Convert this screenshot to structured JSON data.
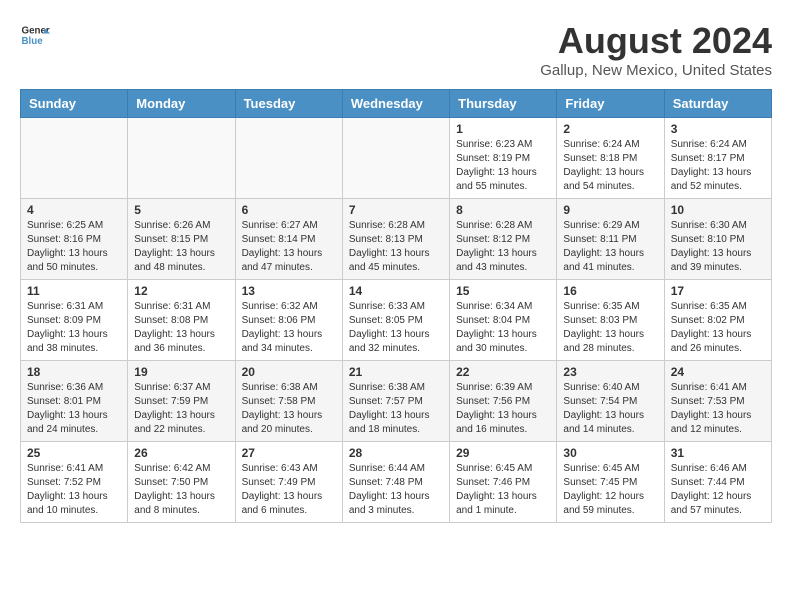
{
  "header": {
    "logo_line1": "General",
    "logo_line2": "Blue",
    "main_title": "August 2024",
    "subtitle": "Gallup, New Mexico, United States"
  },
  "days_of_week": [
    "Sunday",
    "Monday",
    "Tuesday",
    "Wednesday",
    "Thursday",
    "Friday",
    "Saturday"
  ],
  "weeks": [
    [
      {
        "day": "",
        "info": ""
      },
      {
        "day": "",
        "info": ""
      },
      {
        "day": "",
        "info": ""
      },
      {
        "day": "",
        "info": ""
      },
      {
        "day": "1",
        "info": "Sunrise: 6:23 AM\nSunset: 8:19 PM\nDaylight: 13 hours\nand 55 minutes."
      },
      {
        "day": "2",
        "info": "Sunrise: 6:24 AM\nSunset: 8:18 PM\nDaylight: 13 hours\nand 54 minutes."
      },
      {
        "day": "3",
        "info": "Sunrise: 6:24 AM\nSunset: 8:17 PM\nDaylight: 13 hours\nand 52 minutes."
      }
    ],
    [
      {
        "day": "4",
        "info": "Sunrise: 6:25 AM\nSunset: 8:16 PM\nDaylight: 13 hours\nand 50 minutes."
      },
      {
        "day": "5",
        "info": "Sunrise: 6:26 AM\nSunset: 8:15 PM\nDaylight: 13 hours\nand 48 minutes."
      },
      {
        "day": "6",
        "info": "Sunrise: 6:27 AM\nSunset: 8:14 PM\nDaylight: 13 hours\nand 47 minutes."
      },
      {
        "day": "7",
        "info": "Sunrise: 6:28 AM\nSunset: 8:13 PM\nDaylight: 13 hours\nand 45 minutes."
      },
      {
        "day": "8",
        "info": "Sunrise: 6:28 AM\nSunset: 8:12 PM\nDaylight: 13 hours\nand 43 minutes."
      },
      {
        "day": "9",
        "info": "Sunrise: 6:29 AM\nSunset: 8:11 PM\nDaylight: 13 hours\nand 41 minutes."
      },
      {
        "day": "10",
        "info": "Sunrise: 6:30 AM\nSunset: 8:10 PM\nDaylight: 13 hours\nand 39 minutes."
      }
    ],
    [
      {
        "day": "11",
        "info": "Sunrise: 6:31 AM\nSunset: 8:09 PM\nDaylight: 13 hours\nand 38 minutes."
      },
      {
        "day": "12",
        "info": "Sunrise: 6:31 AM\nSunset: 8:08 PM\nDaylight: 13 hours\nand 36 minutes."
      },
      {
        "day": "13",
        "info": "Sunrise: 6:32 AM\nSunset: 8:06 PM\nDaylight: 13 hours\nand 34 minutes."
      },
      {
        "day": "14",
        "info": "Sunrise: 6:33 AM\nSunset: 8:05 PM\nDaylight: 13 hours\nand 32 minutes."
      },
      {
        "day": "15",
        "info": "Sunrise: 6:34 AM\nSunset: 8:04 PM\nDaylight: 13 hours\nand 30 minutes."
      },
      {
        "day": "16",
        "info": "Sunrise: 6:35 AM\nSunset: 8:03 PM\nDaylight: 13 hours\nand 28 minutes."
      },
      {
        "day": "17",
        "info": "Sunrise: 6:35 AM\nSunset: 8:02 PM\nDaylight: 13 hours\nand 26 minutes."
      }
    ],
    [
      {
        "day": "18",
        "info": "Sunrise: 6:36 AM\nSunset: 8:01 PM\nDaylight: 13 hours\nand 24 minutes."
      },
      {
        "day": "19",
        "info": "Sunrise: 6:37 AM\nSunset: 7:59 PM\nDaylight: 13 hours\nand 22 minutes."
      },
      {
        "day": "20",
        "info": "Sunrise: 6:38 AM\nSunset: 7:58 PM\nDaylight: 13 hours\nand 20 minutes."
      },
      {
        "day": "21",
        "info": "Sunrise: 6:38 AM\nSunset: 7:57 PM\nDaylight: 13 hours\nand 18 minutes."
      },
      {
        "day": "22",
        "info": "Sunrise: 6:39 AM\nSunset: 7:56 PM\nDaylight: 13 hours\nand 16 minutes."
      },
      {
        "day": "23",
        "info": "Sunrise: 6:40 AM\nSunset: 7:54 PM\nDaylight: 13 hours\nand 14 minutes."
      },
      {
        "day": "24",
        "info": "Sunrise: 6:41 AM\nSunset: 7:53 PM\nDaylight: 13 hours\nand 12 minutes."
      }
    ],
    [
      {
        "day": "25",
        "info": "Sunrise: 6:41 AM\nSunset: 7:52 PM\nDaylight: 13 hours\nand 10 minutes."
      },
      {
        "day": "26",
        "info": "Sunrise: 6:42 AM\nSunset: 7:50 PM\nDaylight: 13 hours\nand 8 minutes."
      },
      {
        "day": "27",
        "info": "Sunrise: 6:43 AM\nSunset: 7:49 PM\nDaylight: 13 hours\nand 6 minutes."
      },
      {
        "day": "28",
        "info": "Sunrise: 6:44 AM\nSunset: 7:48 PM\nDaylight: 13 hours\nand 3 minutes."
      },
      {
        "day": "29",
        "info": "Sunrise: 6:45 AM\nSunset: 7:46 PM\nDaylight: 13 hours\nand 1 minute."
      },
      {
        "day": "30",
        "info": "Sunrise: 6:45 AM\nSunset: 7:45 PM\nDaylight: 12 hours\nand 59 minutes."
      },
      {
        "day": "31",
        "info": "Sunrise: 6:46 AM\nSunset: 7:44 PM\nDaylight: 12 hours\nand 57 minutes."
      }
    ]
  ]
}
